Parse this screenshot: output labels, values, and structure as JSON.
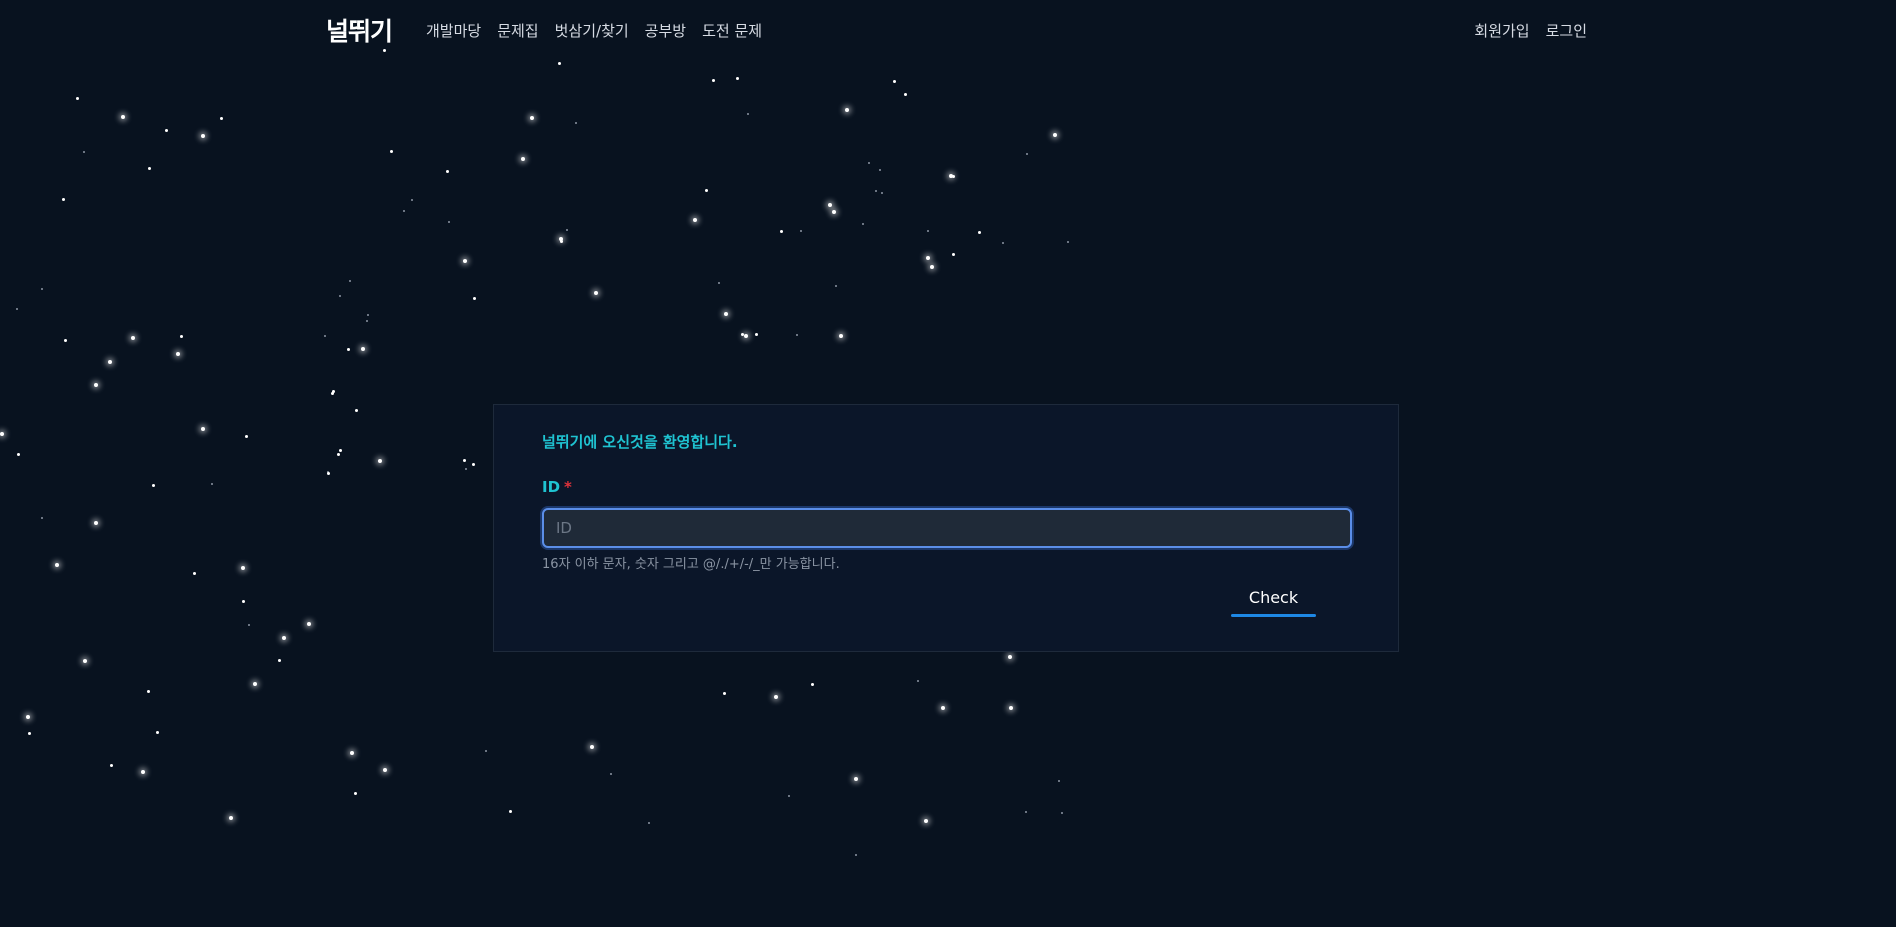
{
  "header": {
    "logo": "널뛰기",
    "nav_left": [
      "개발마당",
      "문제집",
      "벗삼기/찾기",
      "공부방",
      "도전 문제"
    ],
    "nav_right": [
      "회원가입",
      "로그인"
    ]
  },
  "login_card": {
    "welcome": "널뛰기에 오신것을 환영합니다.",
    "id_label": "ID",
    "required_mark": "*",
    "id_placeholder": "ID",
    "id_value": "",
    "hint": "16자 이하 문자, 숫자 그리고 @/./+/-/_만 가능합니다.",
    "check_label": "Check"
  },
  "colors": {
    "background": "#08121f",
    "card": "#0b1629",
    "accent_teal": "#1fc3d1",
    "required_red": "#e0323b",
    "button_underline": "#1e88e5"
  },
  "icons": [
    "star-decoration"
  ]
}
